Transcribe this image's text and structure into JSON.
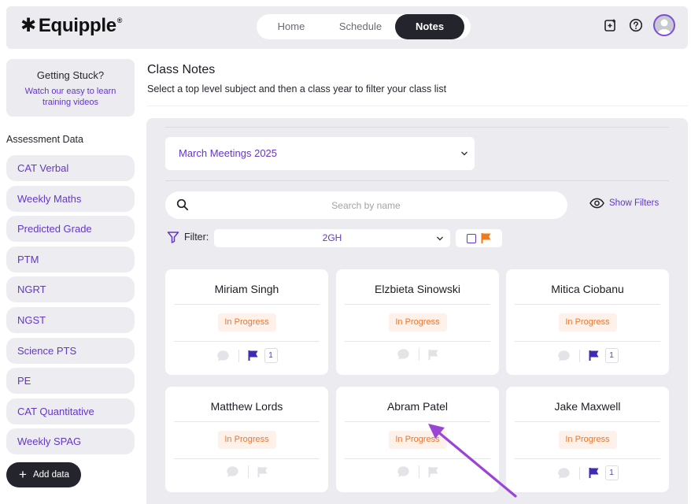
{
  "header": {
    "logo_text": "Equipple",
    "logo_mark": "✱",
    "logo_reg": "®",
    "tabs": [
      {
        "label": "Home",
        "active": false
      },
      {
        "label": "Schedule",
        "active": false
      },
      {
        "label": "Notes",
        "active": true
      }
    ],
    "icons": [
      "add-note-icon",
      "help-icon",
      "user-avatar"
    ]
  },
  "sidebar": {
    "help_title": "Getting Stuck?",
    "help_link": "Watch our easy to learn training videos",
    "heading": "Assessment Data",
    "items": [
      {
        "label": "CAT Verbal"
      },
      {
        "label": "Weekly Maths"
      },
      {
        "label": "Predicted Grade"
      },
      {
        "label": "PTM"
      },
      {
        "label": "NGRT"
      },
      {
        "label": "NGST"
      },
      {
        "label": "Science PTS"
      },
      {
        "label": "PE"
      },
      {
        "label": "CAT Quantitative"
      },
      {
        "label": "Weekly SPAG"
      }
    ],
    "add_data_label": "Add data"
  },
  "main": {
    "title": "Class Notes",
    "subtitle": "Select a top level subject and then a class year to filter your class list",
    "meeting_select": "March Meetings 2025",
    "search_placeholder": "Search by name",
    "show_filters": "Show Filters",
    "filter_label": "Filter:",
    "filter_value": "2GH",
    "cards": [
      {
        "name": "Miriam Singh",
        "status": "In Progress",
        "flagged": true,
        "count": "1"
      },
      {
        "name": "Elzbieta Sinowski",
        "status": "In Progress",
        "flagged": false,
        "count": null
      },
      {
        "name": "Mitica Ciobanu",
        "status": "In Progress",
        "flagged": true,
        "count": "1"
      },
      {
        "name": "Matthew Lords",
        "status": "In Progress",
        "flagged": false,
        "count": null
      },
      {
        "name": "Abram Patel",
        "status": "In Progress",
        "flagged": false,
        "count": null
      },
      {
        "name": "Jake Maxwell",
        "status": "In Progress",
        "flagged": true,
        "count": "1"
      }
    ]
  },
  "colors": {
    "accent": "#6437c8",
    "status_orange": "#e9772f",
    "dark": "#24242c",
    "panel": "#ebebf0",
    "annotation_arrow": "#9b45d6"
  }
}
